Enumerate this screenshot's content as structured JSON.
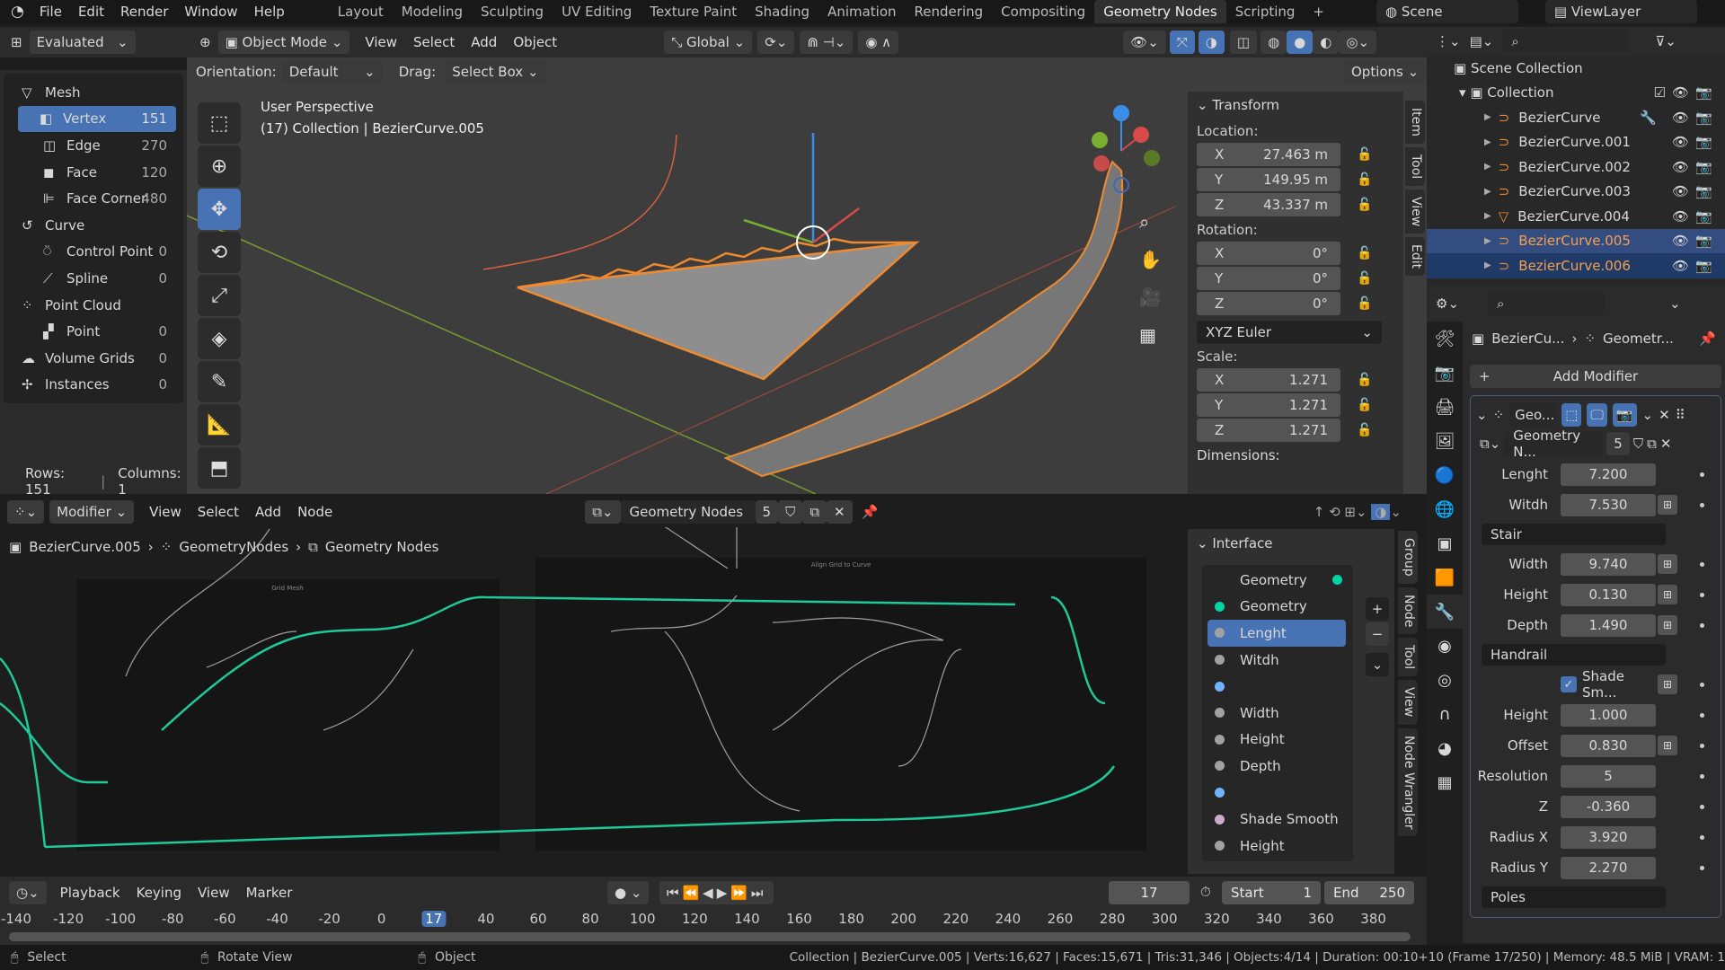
{
  "topbar": {
    "menus": [
      "File",
      "Edit",
      "Render",
      "Window",
      "Help"
    ],
    "workspaces": [
      "Layout",
      "Modeling",
      "Sculpting",
      "UV Editing",
      "Texture Paint",
      "Shading",
      "Animation",
      "Rendering",
      "Compositing",
      "Geometry Nodes",
      "Scripting"
    ],
    "active_workspace": "Geometry Nodes",
    "scene": "Scene",
    "view_layer": "ViewLayer"
  },
  "spreadsheet": {
    "mode": "Evaluated",
    "items": [
      {
        "label": "Mesh",
        "count": "",
        "level": 0,
        "icon": "mesh-icon"
      },
      {
        "label": "Vertex",
        "count": "151",
        "level": 1,
        "icon": "vertex-icon",
        "selected": true
      },
      {
        "label": "Edge",
        "count": "270",
        "level": 1,
        "icon": "edge-icon"
      },
      {
        "label": "Face",
        "count": "120",
        "level": 1,
        "icon": "face-icon"
      },
      {
        "label": "Face Corner",
        "count": "480",
        "level": 1,
        "icon": "face-corner-icon"
      },
      {
        "label": "Curve",
        "count": "",
        "level": 0,
        "icon": "curve-icon"
      },
      {
        "label": "Control Point",
        "count": "0",
        "level": 1,
        "icon": "control-point-icon"
      },
      {
        "label": "Spline",
        "count": "0",
        "level": 1,
        "icon": "spline-icon"
      },
      {
        "label": "Point Cloud",
        "count": "",
        "level": 0,
        "icon": "point-cloud-icon"
      },
      {
        "label": "Point",
        "count": "0",
        "level": 1,
        "icon": "point-icon"
      },
      {
        "label": "Volume Grids",
        "count": "0",
        "level": 0,
        "icon": "volume-icon"
      },
      {
        "label": "Instances",
        "count": "0",
        "level": 0,
        "icon": "instances-icon"
      }
    ],
    "rows": "Rows: 151",
    "columns": "Columns: 1"
  },
  "viewport": {
    "mode": "Object Mode",
    "menus": [
      "View",
      "Select",
      "Add",
      "Object"
    ],
    "transform_orientation": "Global",
    "orientation_label": "Orientation:",
    "orientation": "Default",
    "drag_label": "Drag:",
    "drag": "Select Box",
    "options": "Options",
    "title": "User Perspective",
    "subtitle": "(17) Collection | BezierCurve.005"
  },
  "npanel": {
    "title": "Transform",
    "location_label": "Location:",
    "location": [
      {
        "axis": "X",
        "value": "27.463 m"
      },
      {
        "axis": "Y",
        "value": "149.95 m"
      },
      {
        "axis": "Z",
        "value": "43.337 m"
      }
    ],
    "rotation_label": "Rotation:",
    "rotation": [
      {
        "axis": "X",
        "value": "0°"
      },
      {
        "axis": "Y",
        "value": "0°"
      },
      {
        "axis": "Z",
        "value": "0°"
      }
    ],
    "rotation_mode": "XYZ Euler",
    "scale_label": "Scale:",
    "scale": [
      {
        "axis": "X",
        "value": "1.271"
      },
      {
        "axis": "Y",
        "value": "1.271"
      },
      {
        "axis": "Z",
        "value": "1.271"
      }
    ],
    "dimensions_label": "Dimensions:",
    "tabs": [
      "Item",
      "Tool",
      "View",
      "Edit"
    ]
  },
  "outliner": {
    "root": "Scene Collection",
    "collection": "Collection",
    "objects": [
      {
        "name": "BezierCurve",
        "state": ""
      },
      {
        "name": "BezierCurve.001",
        "state": ""
      },
      {
        "name": "BezierCurve.002",
        "state": ""
      },
      {
        "name": "BezierCurve.003",
        "state": ""
      },
      {
        "name": "BezierCurve.004",
        "state": ""
      },
      {
        "name": "BezierCurve.005",
        "state": "active"
      },
      {
        "name": "BezierCurve.006",
        "state": "selected"
      }
    ]
  },
  "properties": {
    "breadcrumb_object": "BezierCu...",
    "breadcrumb_modifier": "Geometr...",
    "add_modifier": "Add Modifier",
    "modifier_name": "Geo...",
    "node_group": "Geometry N...",
    "users": "5",
    "inputs": [
      {
        "label": "Lenght",
        "value": "7.200",
        "attr": false
      },
      {
        "label": "Witdh",
        "value": "7.530",
        "attr": true
      }
    ],
    "stair_label": "Stair",
    "stair": [
      {
        "label": "Width",
        "value": "9.740",
        "attr": true
      },
      {
        "label": "Height",
        "value": "0.130",
        "attr": true
      },
      {
        "label": "Depth",
        "value": "1.490",
        "attr": true
      }
    ],
    "handrail_label": "Handrail",
    "shade_smooth": "Shade Sm...",
    "shade_smooth_checked": true,
    "handrail": [
      {
        "label": "Height",
        "value": "1.000",
        "attr": false
      },
      {
        "label": "Offset",
        "value": "0.830",
        "attr": true
      },
      {
        "label": "Resolution",
        "value": "5",
        "attr": false
      },
      {
        "label": "Z",
        "value": "-0.360",
        "attr": false
      },
      {
        "label": "Radius X",
        "value": "3.920",
        "attr": false
      },
      {
        "label": "Radius Y",
        "value": "2.270",
        "attr": false
      }
    ],
    "poles_label": "Poles"
  },
  "node_editor": {
    "context": "Modifier",
    "menus": [
      "View",
      "Select",
      "Add",
      "Node"
    ],
    "node_group": "Geometry Nodes",
    "users": "5",
    "breadcrumb": [
      "BezierCurve.005",
      "GeometryNodes",
      "Geometry Nodes"
    ],
    "frame_labels": [
      "Grid Mesh",
      "Align Grid to Curve"
    ],
    "interface_title": "Interface",
    "tabs": [
      "Group",
      "Node",
      "Tool",
      "View",
      "Node Wrangler"
    ],
    "interface": [
      {
        "label": "Geometry",
        "socket": "#00d6a3",
        "output": true
      },
      {
        "label": "Geometry",
        "socket": "#00d6a3"
      },
      {
        "label": "Lenght",
        "socket": "#a1a1a1",
        "selected": true
      },
      {
        "label": "Witdh",
        "socket": "#a1a1a1"
      },
      {
        "label": "",
        "socket": "#6fb3ff"
      },
      {
        "label": "Width",
        "socket": "#a1a1a1"
      },
      {
        "label": "Height",
        "socket": "#a1a1a1"
      },
      {
        "label": "Depth",
        "socket": "#a1a1a1"
      },
      {
        "label": "",
        "socket": "#6fb3ff"
      },
      {
        "label": "Shade Smooth",
        "socket": "#ccaacc"
      },
      {
        "label": "Height",
        "socket": "#a1a1a1"
      }
    ]
  },
  "timeline": {
    "menus": [
      "Playback",
      "Keying",
      "View",
      "Marker"
    ],
    "current_frame": "17",
    "start_label": "Start",
    "start": "1",
    "end_label": "End",
    "end": "250",
    "ticks": [
      "-140",
      "-120",
      "-100",
      "-80",
      "-60",
      "-40",
      "-20",
      "0",
      "17",
      "40",
      "60",
      "80",
      "100",
      "120",
      "140",
      "160",
      "180",
      "200",
      "220",
      "240",
      "260",
      "280",
      "300",
      "320",
      "340",
      "360",
      "380"
    ]
  },
  "status": {
    "select": "Select",
    "rotate": "Rotate View",
    "object": "Object",
    "info": "Collection | BezierCurve.005 | Verts:16,627 | Faces:15,671 | Tris:31,346 | Objects:4/14 | Duration: 00:10+10 (Frame 17/250) | Memory: 48.5 MiB | VRAM: 1"
  },
  "colors": {
    "accent": "#4772b3",
    "selection_orange": "#f08a30",
    "node_link_green": "#1ec99a"
  }
}
